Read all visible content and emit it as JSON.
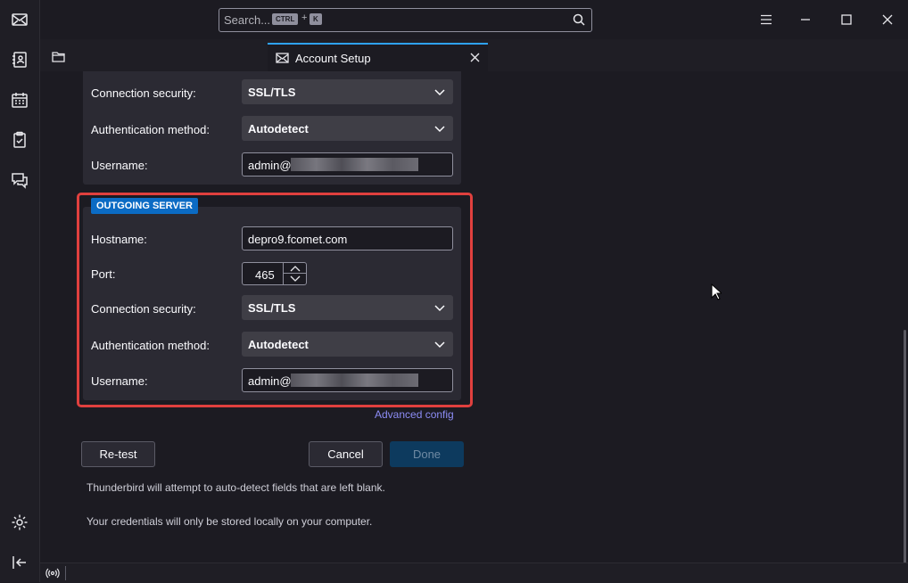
{
  "app": {
    "search_placeholder": "Search...",
    "shortcut_key1": "CTRL",
    "shortcut_plus": "+",
    "shortcut_key2": "K"
  },
  "tab": {
    "title": "Account Setup"
  },
  "incoming": {
    "connection_security_label": "Connection security:",
    "connection_security_value": "SSL/TLS",
    "auth_method_label": "Authentication method:",
    "auth_method_value": "Autodetect",
    "username_label": "Username:",
    "username_value": "admin@"
  },
  "outgoing": {
    "badge": "OUTGOING SERVER",
    "hostname_label": "Hostname:",
    "hostname_value": "depro9.fcomet.com",
    "port_label": "Port:",
    "port_value": "465",
    "connection_security_label": "Connection security:",
    "connection_security_value": "SSL/TLS",
    "auth_method_label": "Authentication method:",
    "auth_method_value": "Autodetect",
    "username_label": "Username:",
    "username_value": "admin@"
  },
  "links": {
    "advanced_config": "Advanced config"
  },
  "buttons": {
    "retest": "Re-test",
    "cancel": "Cancel",
    "done": "Done"
  },
  "hints": {
    "autodetect": "Thunderbird will attempt to auto-detect fields that are left blank.",
    "credentials": "Your credentials will only be stored locally on your computer."
  },
  "colors": {
    "accent": "#0b6bc4",
    "highlight": "#e0403e",
    "link": "#8c8cf5"
  }
}
